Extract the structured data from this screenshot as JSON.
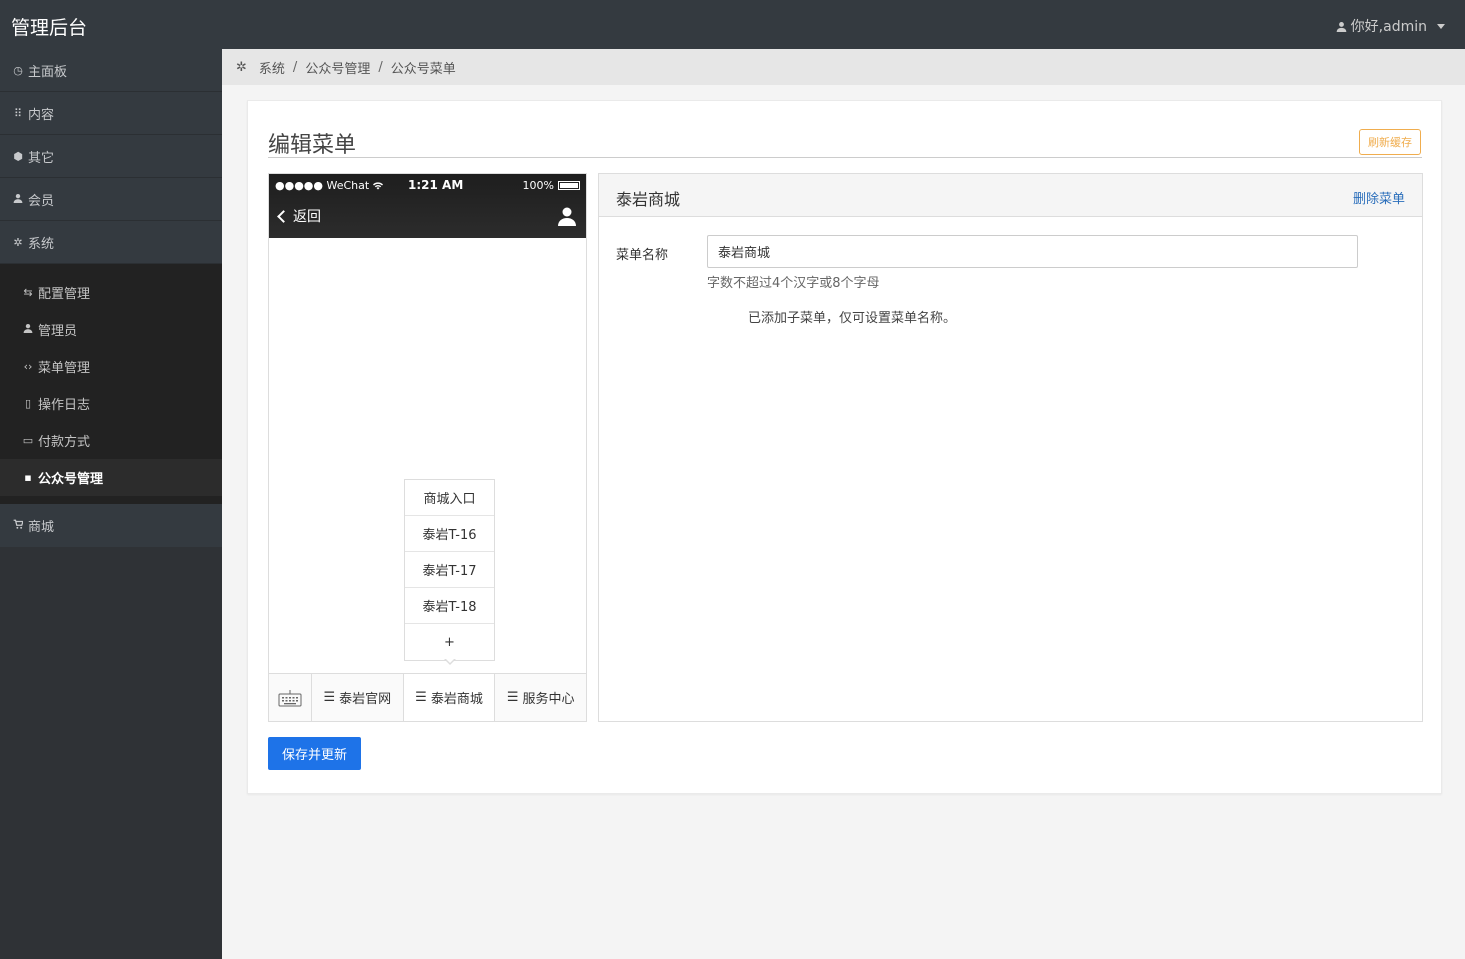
{
  "app": {
    "title": "管理后台",
    "user_greeting": "你好,admin"
  },
  "sidebar": {
    "top_items": [
      {
        "label": "主面板",
        "icon": "dashboard-icon"
      },
      {
        "label": "内容",
        "icon": "grid-icon"
      },
      {
        "label": "其它",
        "icon": "box-icon"
      },
      {
        "label": "会员",
        "icon": "user-icon"
      },
      {
        "label": "系统",
        "icon": "gear-icon"
      }
    ],
    "sub_items": [
      {
        "label": "配置管理",
        "icon": "sliders-icon"
      },
      {
        "label": "管理员",
        "icon": "user-icon"
      },
      {
        "label": "菜单管理",
        "icon": "code-icon"
      },
      {
        "label": "操作日志",
        "icon": "clipboard-icon"
      },
      {
        "label": "付款方式",
        "icon": "credit-card-icon"
      },
      {
        "label": "公众号管理",
        "icon": "chat-icon",
        "active": true
      }
    ],
    "shop_item": {
      "label": "商城",
      "icon": "cart-icon"
    }
  },
  "breadcrumb": [
    "系统",
    "公众号管理",
    "公众号菜单"
  ],
  "page": {
    "title": "编辑菜单",
    "refresh_label": "刷新缓存",
    "save_label": "保存并更新"
  },
  "phone": {
    "carrier": "●●●●● WeChat",
    "time": "1:21 AM",
    "battery": "100%",
    "back_label": "返回",
    "submenu": [
      "商城入口",
      "泰岩T-16",
      "泰岩T-17",
      "泰岩T-18",
      "+"
    ],
    "tabs": [
      "泰岩官网",
      "泰岩商城",
      "服务中心"
    ],
    "active_tab": 1
  },
  "editor": {
    "title": "泰岩商城",
    "delete_label": "删除菜单",
    "field_label": "菜单名称",
    "field_value": "泰岩商城",
    "hint": "字数不超过4个汉字或8个字母",
    "notice": "已添加子菜单，仅可设置菜单名称。"
  }
}
